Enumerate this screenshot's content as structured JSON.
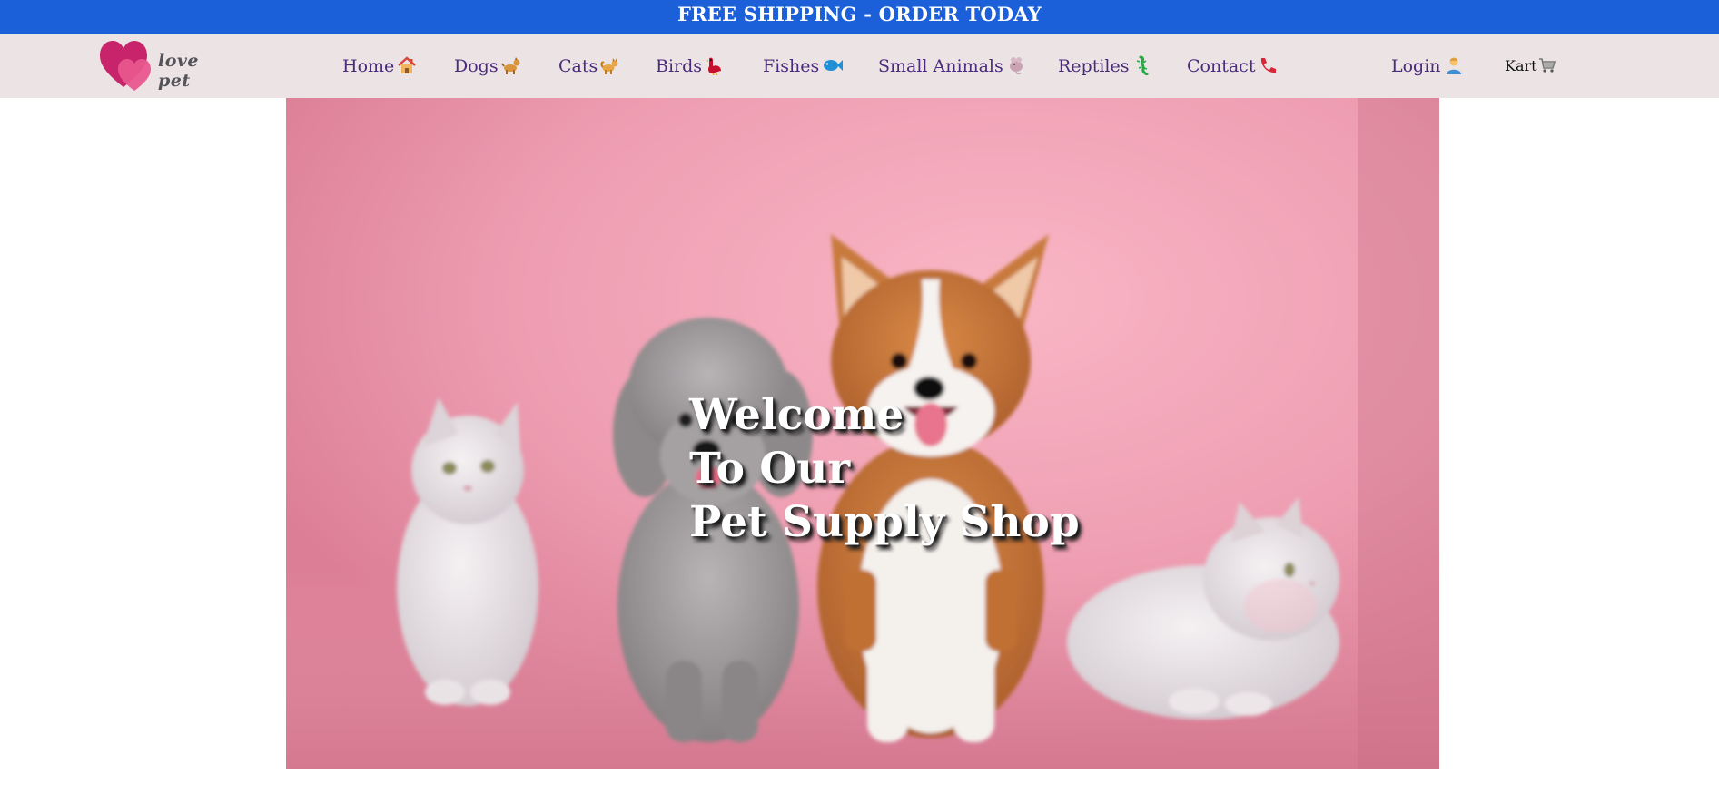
{
  "banner": {
    "text": "FREE SHIPPING - ORDER TODAY",
    "background": "#1b5fd9"
  },
  "logo": {
    "text": "love pet",
    "icon": "double-heart-icon"
  },
  "nav": {
    "items": [
      {
        "label": "Home",
        "icon": "house-icon"
      },
      {
        "label": "Dogs",
        "icon": "dog-icon"
      },
      {
        "label": "Cats",
        "icon": "cat-icon"
      },
      {
        "label": "Birds",
        "icon": "bird-icon"
      },
      {
        "label": "Fishes",
        "icon": "fish-icon"
      },
      {
        "label": "Small Animals",
        "icon": "rat-icon"
      },
      {
        "label": "Reptiles",
        "icon": "lizard-icon"
      },
      {
        "label": "Contact",
        "icon": "telephone-icon"
      }
    ],
    "login": {
      "label": "Login",
      "icon": "person-icon"
    },
    "cart": {
      "label": "Kart",
      "icon": "shopping-cart-icon"
    },
    "link_color": "#4c2b7d",
    "background": "#ece4e4"
  },
  "hero": {
    "line1": "Welcome",
    "line2": "To Our",
    "line3": "Pet Supply Shop",
    "image": "pets-on-pink-background"
  }
}
